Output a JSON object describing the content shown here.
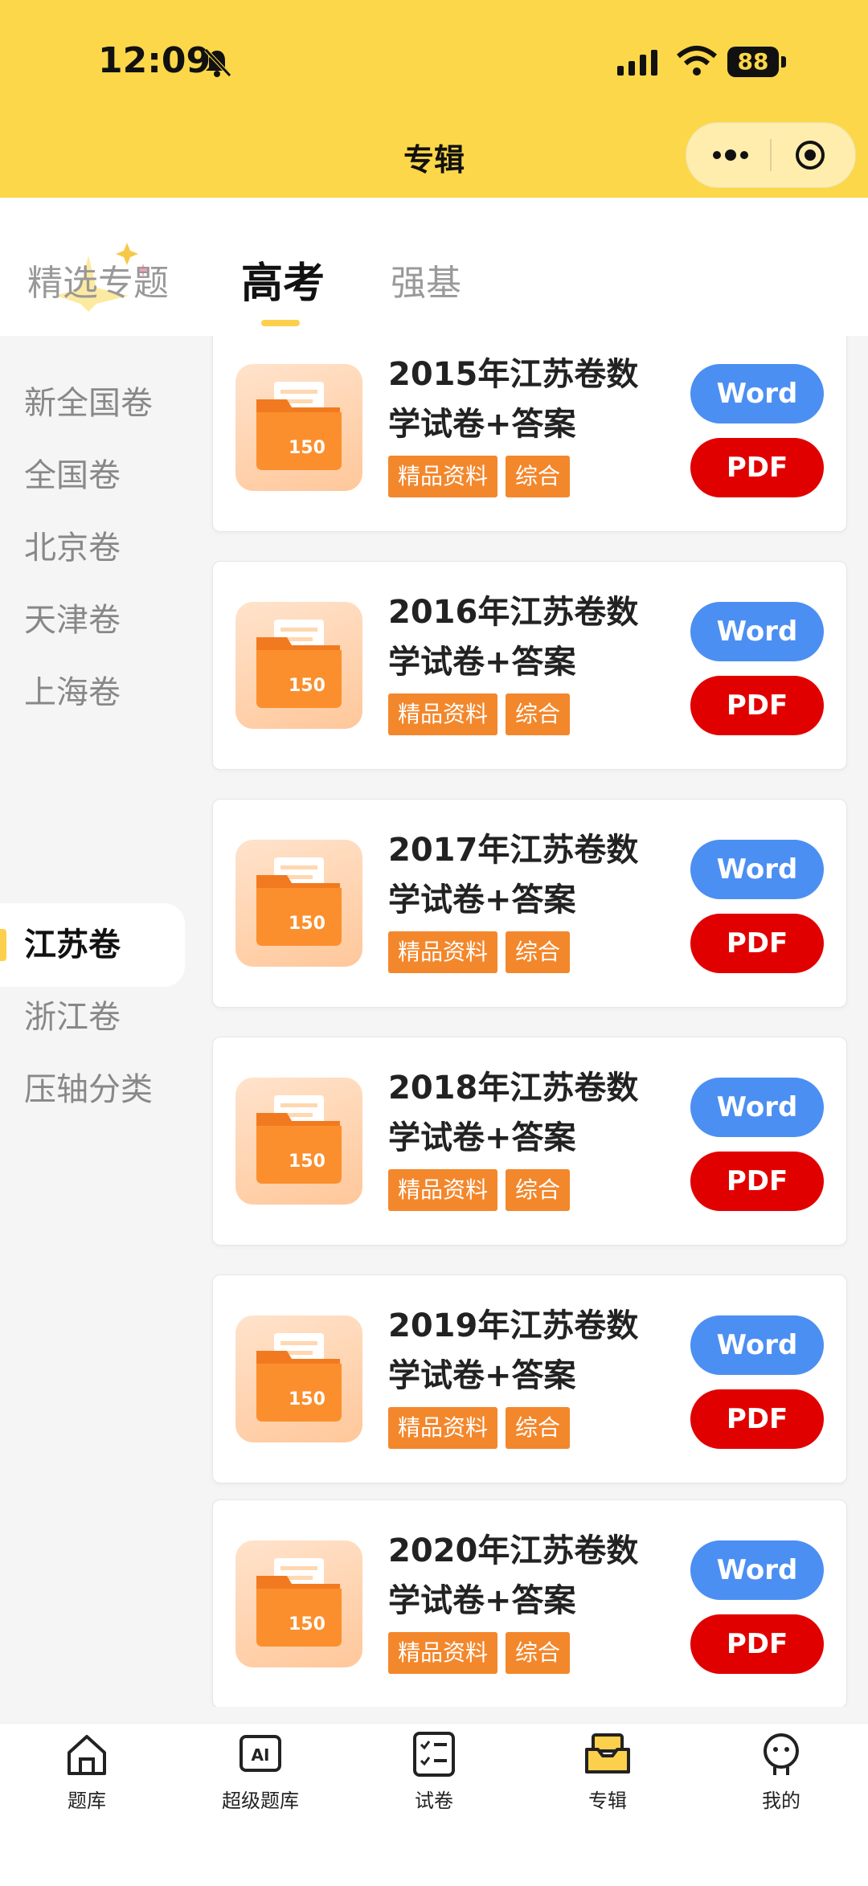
{
  "status_bar": {
    "time": "12:09",
    "battery": "88"
  },
  "nav": {
    "title": "专辑"
  },
  "tabs": [
    {
      "label": "精选专题"
    },
    {
      "label": "高考"
    },
    {
      "label": "强基"
    }
  ],
  "sidebar": {
    "items": [
      {
        "label": "新全国卷"
      },
      {
        "label": "全国卷"
      },
      {
        "label": "北京卷"
      },
      {
        "label": "天津卷"
      },
      {
        "label": "上海卷"
      },
      {
        "label": "江苏卷"
      },
      {
        "label": "浙江卷"
      },
      {
        "label": "压轴分类"
      }
    ],
    "active": "江苏卷"
  },
  "cards": [
    {
      "title": "2015年江苏卷数学试卷+答案",
      "tags": [
        "精品资料",
        "综合"
      ],
      "word": "Word",
      "pdf": "PDF",
      "badge": "150"
    },
    {
      "title": "2016年江苏卷数学试卷+答案",
      "tags": [
        "精品资料",
        "综合"
      ],
      "word": "Word",
      "pdf": "PDF",
      "badge": "150"
    },
    {
      "title": "2017年江苏卷数学试卷+答案",
      "tags": [
        "精品资料",
        "综合"
      ],
      "word": "Word",
      "pdf": "PDF",
      "badge": "150"
    },
    {
      "title": "2018年江苏卷数学试卷+答案",
      "tags": [
        "精品资料",
        "综合"
      ],
      "word": "Word",
      "pdf": "PDF",
      "badge": "150"
    },
    {
      "title": "2019年江苏卷数学试卷+答案",
      "tags": [
        "精品资料",
        "综合"
      ],
      "word": "Word",
      "pdf": "PDF",
      "badge": "150"
    },
    {
      "title": "2020年江苏卷数学试卷+答案",
      "tags": [
        "精品资料",
        "综合"
      ],
      "word": "Word",
      "pdf": "PDF",
      "badge": "150"
    }
  ],
  "tabbar": {
    "items": [
      {
        "label": "题库",
        "icon": "home-icon"
      },
      {
        "label": "超级题库",
        "icon": "ai-icon"
      },
      {
        "label": "试卷",
        "icon": "checklist-icon"
      },
      {
        "label": "专辑",
        "icon": "inbox-icon"
      },
      {
        "label": "我的",
        "icon": "profile-icon"
      }
    ],
    "active": "专辑"
  },
  "colors": {
    "header": "#fcd749",
    "word_button": "#4c8ff2",
    "pdf_button": "#e10000",
    "tag": "#f3872c",
    "accent": "#fcd04c"
  }
}
